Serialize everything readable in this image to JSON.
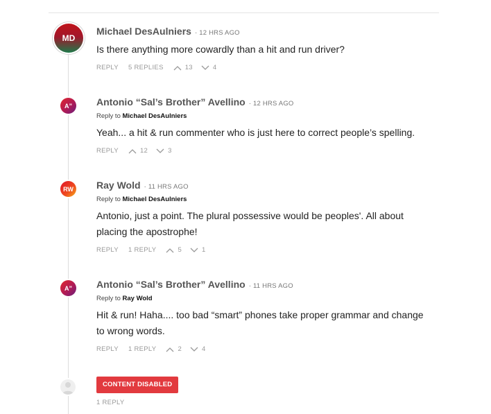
{
  "labels": {
    "reply": "REPLY",
    "reply_to_prefix": "Reply to",
    "dot": "·"
  },
  "comments": [
    {
      "initials": "MD",
      "author": "Michael DesAulniers",
      "time": "12 HRS AGO",
      "body": "Is there anything more cowardly than a hit and run driver?",
      "replies": "5 REPLIES",
      "upvotes": "13",
      "downvotes": "4"
    },
    {
      "initials": "A”",
      "author": "Antonio “Sal’s Brother” Avellino",
      "time": "12 HRS AGO",
      "reply_to": "Michael DesAulniers",
      "body": "Yeah... a hit & run commenter who is just here to correct people’s spelling.",
      "upvotes": "12",
      "downvotes": "3"
    },
    {
      "initials": "RW",
      "author": "Ray Wold",
      "time": "11 HRS AGO",
      "reply_to": "Michael DesAulniers",
      "body": "Antonio, just a point. The plural possessive would be peoples'. All about placing the apostrophe!",
      "replies": "1 REPLY",
      "upvotes": "5",
      "downvotes": "1"
    },
    {
      "initials": "A”",
      "author": "Antonio “Sal’s Brother” Avellino",
      "time": "11 HRS AGO",
      "reply_to": "Ray Wold",
      "body": "Hit & run! Haha.... too bad “smart” phones take proper grammar and change to wrong words.",
      "replies": "1 REPLY",
      "upvotes": "2",
      "downvotes": "4"
    }
  ],
  "disabled": {
    "button": "CONTENT DISABLED",
    "replies": "1 REPLY"
  },
  "colors": {
    "disabled_red": "#e23a3f",
    "meta_gray": "#999999"
  },
  "icons": {
    "upvote": "chevron-up-icon",
    "downvote": "chevron-down-icon"
  }
}
